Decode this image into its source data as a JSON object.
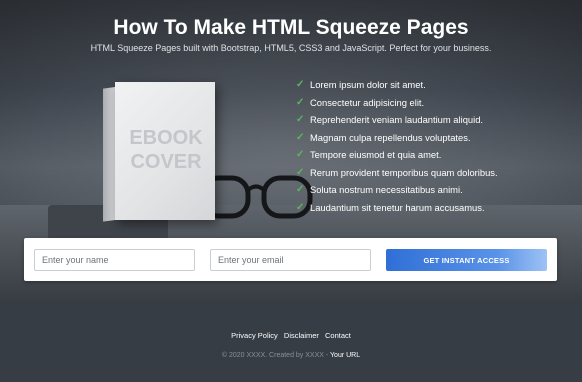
{
  "header": {
    "title": "How To Make HTML Squeeze Pages",
    "subtitle": "HTML Squeeze Pages built with Bootstrap, HTML5, CSS3 and JavaScript. Perfect for your business."
  },
  "ebook": {
    "cover_line1": "EBOOK",
    "cover_line2": "COVER"
  },
  "features": [
    "Lorem ipsum dolor sit amet.",
    "Consectetur adipisicing elit.",
    "Reprehenderit veniam laudantium aliquid.",
    "Magnam culpa repellendus voluptates.",
    "Tempore eiusmod et quia amet.",
    "Rerum provident temporibus quam doloribus.",
    "Soluta nostrum necessitatibus animi.",
    "Laudantium sit tenetur harum accusamus."
  ],
  "form": {
    "name_placeholder": "Enter your name",
    "name_value": "",
    "email_placeholder": "Enter your email",
    "email_value": "",
    "submit_label": "GET INSTANT ACCESS"
  },
  "footer": {
    "links": [
      "Privacy Policy",
      "Disclaimer",
      "Contact"
    ],
    "copyright": "© 2020 XXXX. Created by XXXX -",
    "your_url": "Your URL"
  },
  "colors": {
    "check": "#5cb85c",
    "cta_start": "#2f6fd6",
    "footer_bg": "#373d45"
  },
  "icons": {
    "feature_bullet": "check-icon"
  }
}
